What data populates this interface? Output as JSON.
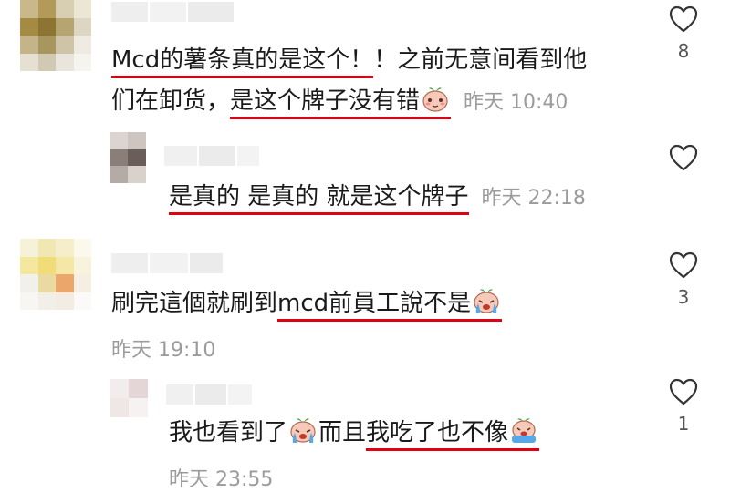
{
  "comments": [
    {
      "pre": "",
      "underlined_1": "Mcd的薯条真的是这个！",
      "mid": "！之前无意间看到他",
      "line2_pre": "们在卸货，",
      "underlined_2": "是这个牌子没有错",
      "emoji": "blushing-face-emoji",
      "time": "昨天 10:40",
      "likes": "8"
    },
    {
      "underlined": "是真的 是真的 就是这个牌子",
      "time": "昨天 22:18",
      "likes": ""
    },
    {
      "pre": "刷完這個就刷到",
      "underlined": "mcd前員工說不是",
      "emoji": "crying-face-emoji",
      "time": "昨天 19:10",
      "likes": "3"
    },
    {
      "pre": "我也看到了",
      "mid": "而且",
      "underlined": "我吃了也不像",
      "emoji1": "crying-face-emoji",
      "emoji2": "crying-face-emoji",
      "time": "昨天 23:55",
      "likes": "1"
    }
  ],
  "colors": {
    "underline": "#e00012",
    "timestamp": "#9b9b9b",
    "background": "#ffffff"
  },
  "icons": {
    "like": "heart-outline-icon"
  }
}
